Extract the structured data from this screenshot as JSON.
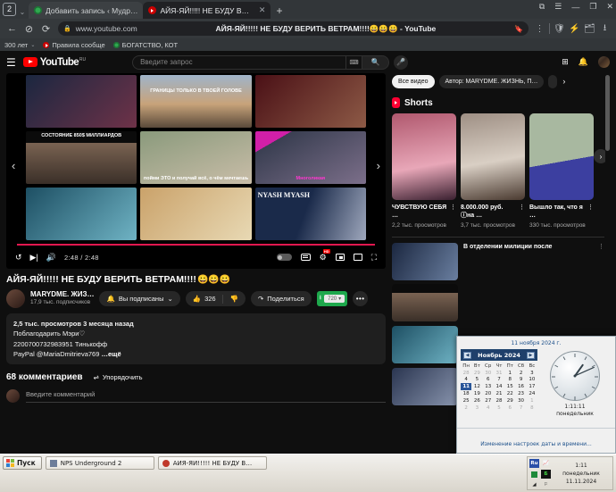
{
  "browser": {
    "tab_count": "2",
    "tabs": [
      {
        "title": "Добавить запись ‹ Мудр…",
        "favicon": "wordpress-icon",
        "active": false
      },
      {
        "title": "АЙЯ-ЯЙ!!!!! НЕ БУДУ В…",
        "favicon": "youtube-icon",
        "active": true
      }
    ],
    "new_tab_label": "+",
    "window_buttons": [
      "cast-icon",
      "menu-icon",
      "minimize-icon",
      "restore-icon",
      "close-icon"
    ],
    "nav": {
      "back": "←",
      "forward_disabled": "⊘",
      "reload": "⟳"
    },
    "address": {
      "lock_icon": "lock-icon",
      "host": "www.youtube.com",
      "page_title": "АЙЯ-ЯЙ!!!!! НЕ БУДУ ВЕРИТЬ ВЕТРАМ!!!!😀😀😀 - YouTube",
      "bookmark_icon": "bookmark-icon"
    },
    "extensions": [
      "kebab-icon",
      "shield-icon",
      "adblock-icon",
      "collections-icon",
      "download-icon"
    ],
    "bookmarks": [
      {
        "label": "300 лет",
        "favicon": "folder-icon"
      },
      {
        "label": "Правила сообще",
        "favicon": "youtube-icon"
      },
      {
        "label": "БОГАТСТВО, КОТ",
        "favicon": "wordpress-icon"
      }
    ]
  },
  "youtube": {
    "masthead": {
      "menu_icon": "hamburger-icon",
      "logo_text": "YouTube",
      "country_code": "RU",
      "search_placeholder": "Введите запрос",
      "keyboard_icon": "keyboard-icon",
      "search_icon": "search-icon",
      "mic_icon": "microphone-icon",
      "create_icon": "create-video-icon",
      "notifications_icon": "bell-icon",
      "avatar": "account-avatar"
    },
    "player": {
      "replay_icon": "replay-icon",
      "next_icon": "next-video-icon",
      "volume_icon": "volume-icon",
      "time": "2:48 / 2:48",
      "autoplay_toggle": "autoplay-toggle",
      "subtitles_icon": "subtitles-icon",
      "settings_icon": "settings-gear-icon",
      "hd_badge": "HD",
      "miniplayer_icon": "miniplayer-icon",
      "theater_icon": "theater-mode-icon",
      "fullscreen_icon": "fullscreen-icon",
      "prev_arrow": "‹",
      "next_arrow": "›",
      "end_screen_thumbnails": [
        {
          "caption": "",
          "c1": "#1b2740",
          "c2": "#6e3248"
        },
        {
          "caption": "ГРАНИЦЫ ТОЛЬКО В ТВОЕЙ ГОЛОВЕ",
          "c1": "#caa municipal",
          "c2": "#c8a37a"
        },
        {
          "caption": "",
          "c1": "#4a1016",
          "c2": "#8d5a46"
        },
        {
          "caption": "СОСТОЯНИЕ 850$ МИЛЛИАРДОВ",
          "c1": "#201a18",
          "c2": "#7a6352"
        },
        {
          "caption": "пойми ЭТО и получай всё, о чём мечтаешь",
          "c1": "#8a9a7c",
          "c2": "#c9bda8"
        },
        {
          "caption": "Многоликая",
          "c1": "#2a2f3a",
          "c2": "#7c6f8a"
        },
        {
          "caption": "",
          "c1": "#1d4f63",
          "c2": "#6fb3c4"
        },
        {
          "caption": "",
          "c1": "#caa26a",
          "c2": "#e8d9b4"
        },
        {
          "caption": "NYASH MYASH",
          "c1": "#1a2a4a",
          "c2": "#9fa8bd"
        }
      ]
    },
    "video": {
      "title": "АЙЯ-ЯЙ!!!!! НЕ БУДУ ВЕРИТЬ ВЕТРАМ!!!!",
      "title_emoji": "😀😀😀",
      "channel_name": "MARYDME. ЖИЗ…",
      "channel_subs": "17,9 тыс. подписчиков",
      "subscribe_label": "Вы подписаны",
      "bell_icon": "bell-icon",
      "chevron_icon": "chevron-down-icon",
      "like_icon": "thumbs-up-icon",
      "like_count": "326",
      "dislike_icon": "thumbs-down-icon",
      "share_icon": "share-icon",
      "share_label": "Поделиться",
      "download_icon": "download-icon",
      "quality_label": "720",
      "more_icon": "more-actions-icon",
      "description": {
        "meta": "2,5 тыс. просмотров  3 месяца назад",
        "line1": "Поблагодарить Мэри♡",
        "line2": "2200700732983951 Тинькофф",
        "line3": "PayPal @MariaDmitrieva769",
        "more": "…ещё"
      },
      "comments_count": "68 комментариев",
      "sort_icon": "sort-icon",
      "sort_label": "Упорядочить",
      "comment_placeholder": "Введите комментарий"
    },
    "sidebar": {
      "chips": [
        {
          "label": "Все видео",
          "selected": true
        },
        {
          "label": "Автор: MARYDME. ЖИЗНЬ, П…",
          "selected": false
        },
        {
          "label": "",
          "selected": false
        }
      ],
      "chip_next_icon": "chevron-right-icon",
      "shorts_header": "Shorts",
      "shorts_icon": "shorts-icon",
      "shorts_next_icon": "chevron-right-icon",
      "shorts": [
        {
          "title": "ЧУВСТВУЮ СЕБЯ …",
          "views": "2,2 тыс. просмотров",
          "c1": "#b0586e",
          "c2": "#e8a7b8",
          "kebab": "kebab-icon"
        },
        {
          "title": "8.000.000 руб. ⓘна …",
          "views": "3,7 тыс. просмотров",
          "c1": "#9e8f84",
          "c2": "#d9cfc4",
          "kebab": "kebab-icon"
        },
        {
          "title": "Вышло так, что я …",
          "views": "330 тыс. просмотров",
          "c1": "#3c3fa0",
          "c2": "#9aa6c9",
          "kebab": "kebab-icon"
        }
      ],
      "recommended": [
        {
          "title": "В отделении милиции после",
          "kebab": "kebab-icon",
          "c1": "#1b2740",
          "c2": "#6a7fa0"
        },
        {
          "title": "",
          "kebab": "kebab-icon",
          "c1": "#201a18",
          "c2": "#7a6352"
        },
        {
          "title": "",
          "kebab": "kebab-icon",
          "c1": "#1d4f63",
          "c2": "#6fb3c4"
        },
        {
          "title": "",
          "kebab": "kebab-icon",
          "c1": "#2a3550",
          "c2": "#8894ad"
        }
      ]
    }
  },
  "windows": {
    "calendar_flyout": {
      "full_date": "11 ноября 2024 г.",
      "month_title": "Ноябрь 2024",
      "prev_icon": "calendar-prev-icon",
      "next_icon": "calendar-next-icon",
      "weekdays": [
        "Пн",
        "Вт",
        "Ср",
        "Чт",
        "Пт",
        "Сб",
        "Вс"
      ],
      "weeks": [
        [
          {
            "d": "28",
            "m": true
          },
          {
            "d": "29",
            "m": true
          },
          {
            "d": "30",
            "m": true
          },
          {
            "d": "31",
            "m": true
          },
          {
            "d": "1",
            "m": false
          },
          {
            "d": "2",
            "m": false
          },
          {
            "d": "3",
            "m": false
          }
        ],
        [
          {
            "d": "4",
            "m": false
          },
          {
            "d": "5",
            "m": false
          },
          {
            "d": "6",
            "m": false
          },
          {
            "d": "7",
            "m": false
          },
          {
            "d": "8",
            "m": false
          },
          {
            "d": "9",
            "m": false
          },
          {
            "d": "10",
            "m": false
          }
        ],
        [
          {
            "d": "11",
            "m": false,
            "sel": true
          },
          {
            "d": "12",
            "m": false
          },
          {
            "d": "13",
            "m": false
          },
          {
            "d": "14",
            "m": false
          },
          {
            "d": "15",
            "m": false
          },
          {
            "d": "16",
            "m": false
          },
          {
            "d": "17",
            "m": false
          }
        ],
        [
          {
            "d": "18",
            "m": false
          },
          {
            "d": "19",
            "m": false
          },
          {
            "d": "20",
            "m": false
          },
          {
            "d": "21",
            "m": false
          },
          {
            "d": "22",
            "m": false
          },
          {
            "d": "23",
            "m": false
          },
          {
            "d": "24",
            "m": false
          }
        ],
        [
          {
            "d": "25",
            "m": false
          },
          {
            "d": "26",
            "m": false
          },
          {
            "d": "27",
            "m": false
          },
          {
            "d": "28",
            "m": false
          },
          {
            "d": "29",
            "m": false
          },
          {
            "d": "30",
            "m": false
          },
          {
            "d": "1",
            "m": true
          }
        ],
        [
          {
            "d": "2",
            "m": true
          },
          {
            "d": "3",
            "m": true
          },
          {
            "d": "4",
            "m": true
          },
          {
            "d": "5",
            "m": true
          },
          {
            "d": "6",
            "m": true
          },
          {
            "d": "7",
            "m": true
          },
          {
            "d": "8",
            "m": true
          }
        ]
      ],
      "clock_time": "1:11:11",
      "clock_day": "понедельник",
      "settings_link": "Изменение настроек даты и времени..."
    },
    "taskbar": {
      "start_label": "Пуск",
      "start_icon": "windows-logo-icon",
      "items": [
        {
          "label": "NPS Underground 2",
          "icon": "app-icon"
        },
        {
          "label": "АЙЯ-ЯЙ!!!!! НЕ БУДУ В…",
          "icon": "browser-icon"
        }
      ],
      "tray_icons": [
        "lang-ru-icon",
        "network-graph-icon",
        "green-square-icon",
        "letter-b-icon",
        "signal-icon",
        "flag-icon",
        "monitor-icon"
      ],
      "lang": "Ru",
      "clock_time": "1:11",
      "clock_day": "понедельник",
      "clock_date": "11.11.2024"
    }
  },
  "colors": {
    "youtube_red": "#ff0000",
    "progress_red": "#e1174f",
    "download_green": "#1ea84c",
    "calendar_select": "#2a5699",
    "chrome_bg": "#323639"
  }
}
